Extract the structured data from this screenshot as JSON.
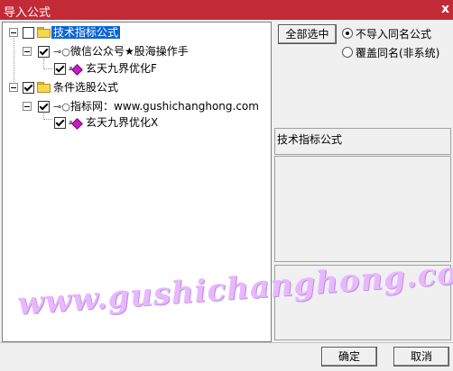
{
  "window": {
    "title": "导入公式",
    "close_glyph": "x"
  },
  "tree": {
    "nodes": [
      {
        "label": "技术指标公式",
        "checked": false,
        "selected": true,
        "icon": "folder-icon"
      },
      {
        "label": "微信公众号★股海操作手",
        "checked": true,
        "icon": "key-icon"
      },
      {
        "label": "玄天九界优化F",
        "checked": true,
        "icon": "formula-icon"
      },
      {
        "label": "条件选股公式",
        "checked": true,
        "icon": "folder-icon"
      },
      {
        "label": "指标网：www.gushichanghong.com",
        "checked": true,
        "icon": "key-icon"
      },
      {
        "label": "玄天九界优化X",
        "checked": true,
        "icon": "formula-icon"
      }
    ]
  },
  "controls": {
    "select_all_label": "全部选中",
    "radio_no_import": "不导入同名公式",
    "radio_overwrite": "覆盖同名(非系统)",
    "radio_selected": "no_import"
  },
  "info_panel": {
    "title": "技术指标公式"
  },
  "watermark": {
    "text": "www.gushichanghong.com"
  },
  "footer": {
    "ok_label": "确定",
    "cancel_label": "取消"
  }
}
